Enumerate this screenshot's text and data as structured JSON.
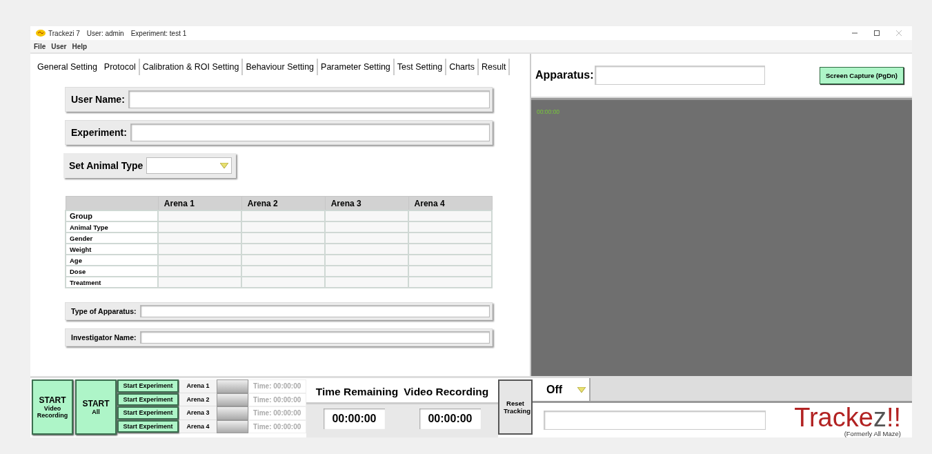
{
  "title_bar": {
    "app": "Trackezi 7",
    "user": "User: admin",
    "experiment": "Experiment: test 1"
  },
  "menu": [
    "File",
    "User",
    "Help"
  ],
  "tabs": [
    {
      "label": "General Setting",
      "selected": true
    },
    {
      "label": "Protocol",
      "selected": false
    },
    {
      "label": "Calibration & ROI Setting",
      "selected": false
    },
    {
      "label": "Behaviour Setting",
      "selected": false
    },
    {
      "label": "Parameter Setting",
      "selected": false
    },
    {
      "label": "Test Setting",
      "selected": false
    },
    {
      "label": "Charts",
      "selected": false
    },
    {
      "label": "Result",
      "selected": false
    }
  ],
  "form": {
    "user_name_label": "User Name:",
    "experiment_label": "Experiment:",
    "animal_type_label": "Set Animal Type",
    "apparatus_type_label": "Type of Apparatus:",
    "investigator_label": "Investigator Name:"
  },
  "table": {
    "columns": [
      "Arena 1",
      "Arena 2",
      "Arena 3",
      "Arena 4"
    ],
    "rows": [
      "Group",
      "Animal Type",
      "Gender",
      "Weight",
      "Age",
      "Dose",
      "Treatment"
    ]
  },
  "apparatus_label": "Apparatus:",
  "screen_capture_button": "Screen Capture (PgDn)",
  "video": {
    "timestamp": "00:00:00"
  },
  "controls": {
    "start_video": {
      "title": "START",
      "subtitle": "Video Recording"
    },
    "start_all": {
      "title": "START",
      "subtitle": "All"
    },
    "arenas": [
      {
        "button": "Start Experiment",
        "arena": "Arena 1",
        "time": "Time: 00:00:00"
      },
      {
        "button": "Start Experiment",
        "arena": "Arena 2",
        "time": "Time: 00:00:00"
      },
      {
        "button": "Start Experiment",
        "arena": "Arena 3",
        "time": "Time: 00:00:00"
      },
      {
        "button": "Start Experiment",
        "arena": "Arena 4",
        "time": "Time: 00:00:00"
      }
    ],
    "time_remaining_label": "Time Remaining",
    "video_recording_label": "Video Recording",
    "time_remaining": "00:00:00",
    "video_recording_time": "00:00:00",
    "reset_button": "Reset Tracking"
  },
  "recording_mode": {
    "value": "Off"
  },
  "logo": {
    "word": "Tracke",
    "mark": "z",
    "tail": "!!",
    "tagline": "(Formerly All Maze)"
  }
}
